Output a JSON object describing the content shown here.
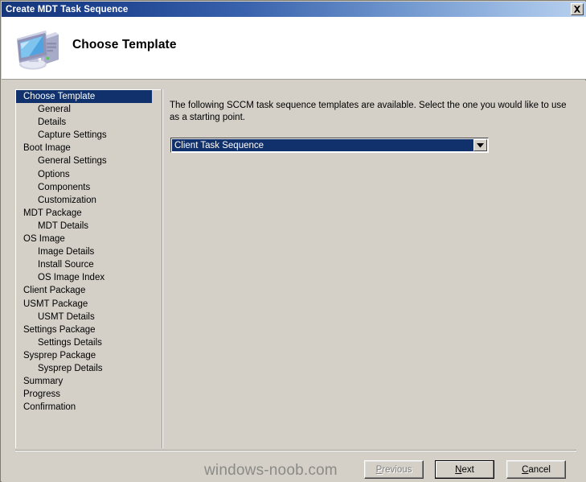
{
  "window": {
    "title": "Create MDT Task Sequence",
    "close_label": "Close",
    "close_icon": "close-x-icon"
  },
  "header": {
    "title": "Choose Template",
    "icon": "computer-monitor-icon"
  },
  "sidebar": {
    "items": [
      {
        "label": "Choose Template",
        "indent": false,
        "selected": true
      },
      {
        "label": "General",
        "indent": true,
        "selected": false
      },
      {
        "label": "Details",
        "indent": true,
        "selected": false
      },
      {
        "label": "Capture Settings",
        "indent": true,
        "selected": false
      },
      {
        "label": "Boot Image",
        "indent": false,
        "selected": false
      },
      {
        "label": "General Settings",
        "indent": true,
        "selected": false
      },
      {
        "label": "Options",
        "indent": true,
        "selected": false
      },
      {
        "label": "Components",
        "indent": true,
        "selected": false
      },
      {
        "label": "Customization",
        "indent": true,
        "selected": false
      },
      {
        "label": "MDT Package",
        "indent": false,
        "selected": false
      },
      {
        "label": "MDT Details",
        "indent": true,
        "selected": false
      },
      {
        "label": "OS Image",
        "indent": false,
        "selected": false
      },
      {
        "label": "Image Details",
        "indent": true,
        "selected": false
      },
      {
        "label": "Install Source",
        "indent": true,
        "selected": false
      },
      {
        "label": "OS Image Index",
        "indent": true,
        "selected": false
      },
      {
        "label": "Client Package",
        "indent": false,
        "selected": false
      },
      {
        "label": "USMT Package",
        "indent": false,
        "selected": false
      },
      {
        "label": "USMT Details",
        "indent": true,
        "selected": false
      },
      {
        "label": "Settings Package",
        "indent": false,
        "selected": false
      },
      {
        "label": "Settings Details",
        "indent": true,
        "selected": false
      },
      {
        "label": "Sysprep Package",
        "indent": false,
        "selected": false
      },
      {
        "label": "Sysprep Details",
        "indent": true,
        "selected": false
      },
      {
        "label": "Summary",
        "indent": false,
        "selected": false
      },
      {
        "label": "Progress",
        "indent": false,
        "selected": false
      },
      {
        "label": "Confirmation",
        "indent": false,
        "selected": false
      }
    ]
  },
  "content": {
    "instruction": "The following SCCM task sequence templates are available.  Select the one you would like to use as a starting point.",
    "template_select": {
      "selected": "Client Task Sequence",
      "arrow_icon": "chevron-down-icon"
    }
  },
  "footer": {
    "previous": {
      "label": "Previous",
      "accel": "P",
      "disabled": true
    },
    "next": {
      "label": "Next",
      "accel": "N",
      "default": true
    },
    "cancel": {
      "label": "Cancel",
      "accel": "C",
      "default": false
    }
  },
  "watermark": {
    "text": "windows-noob.com"
  },
  "colors": {
    "titlebar_start": "#16377a",
    "titlebar_end": "#b8d0ee",
    "selection": "#10316b",
    "face": "#d4d0c8",
    "watermark": "#8b8b86"
  }
}
